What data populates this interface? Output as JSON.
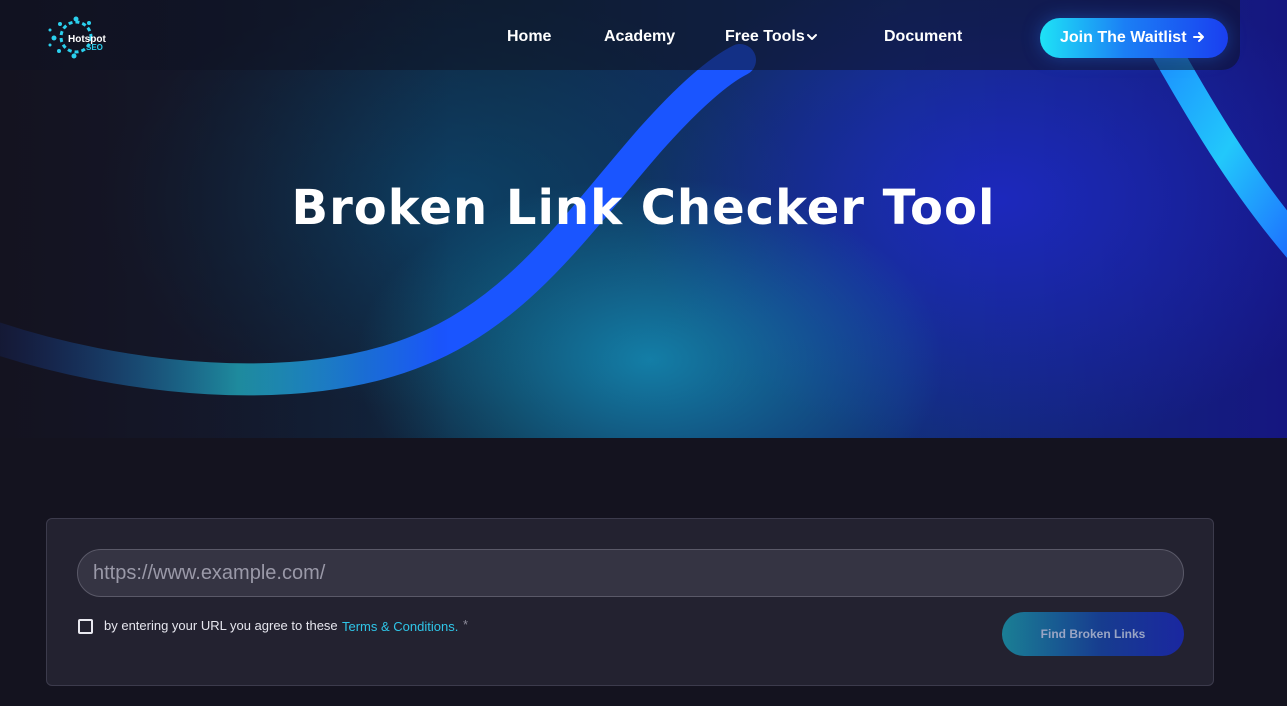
{
  "brand": {
    "logo_text_top": "Hotspot",
    "logo_text_bottom": "SEO"
  },
  "nav": {
    "items": [
      {
        "label": "Home"
      },
      {
        "label": "Academy"
      },
      {
        "label": "Free Tools"
      },
      {
        "label": "Document"
      }
    ],
    "cta_label": "Join The Waitlist"
  },
  "hero": {
    "title": "Broken Link Checker Tool"
  },
  "form": {
    "url_placeholder": "https://www.example.com/",
    "url_value": "",
    "agree_text": "by entering your URL you agree to these",
    "terms_link": "Terms & Conditions.",
    "required_mark": "*",
    "checked": false,
    "submit_label": "Find Broken Links"
  },
  "icons": {
    "free_tools": "chevron-down-icon",
    "cta": "arrow-right-icon"
  },
  "colors": {
    "page_bg": "#14131f",
    "accent_cyan": "#1ee3f6",
    "accent_blue": "#1a3ff0",
    "link": "#2fc6e8",
    "card_bg": "#232230"
  }
}
